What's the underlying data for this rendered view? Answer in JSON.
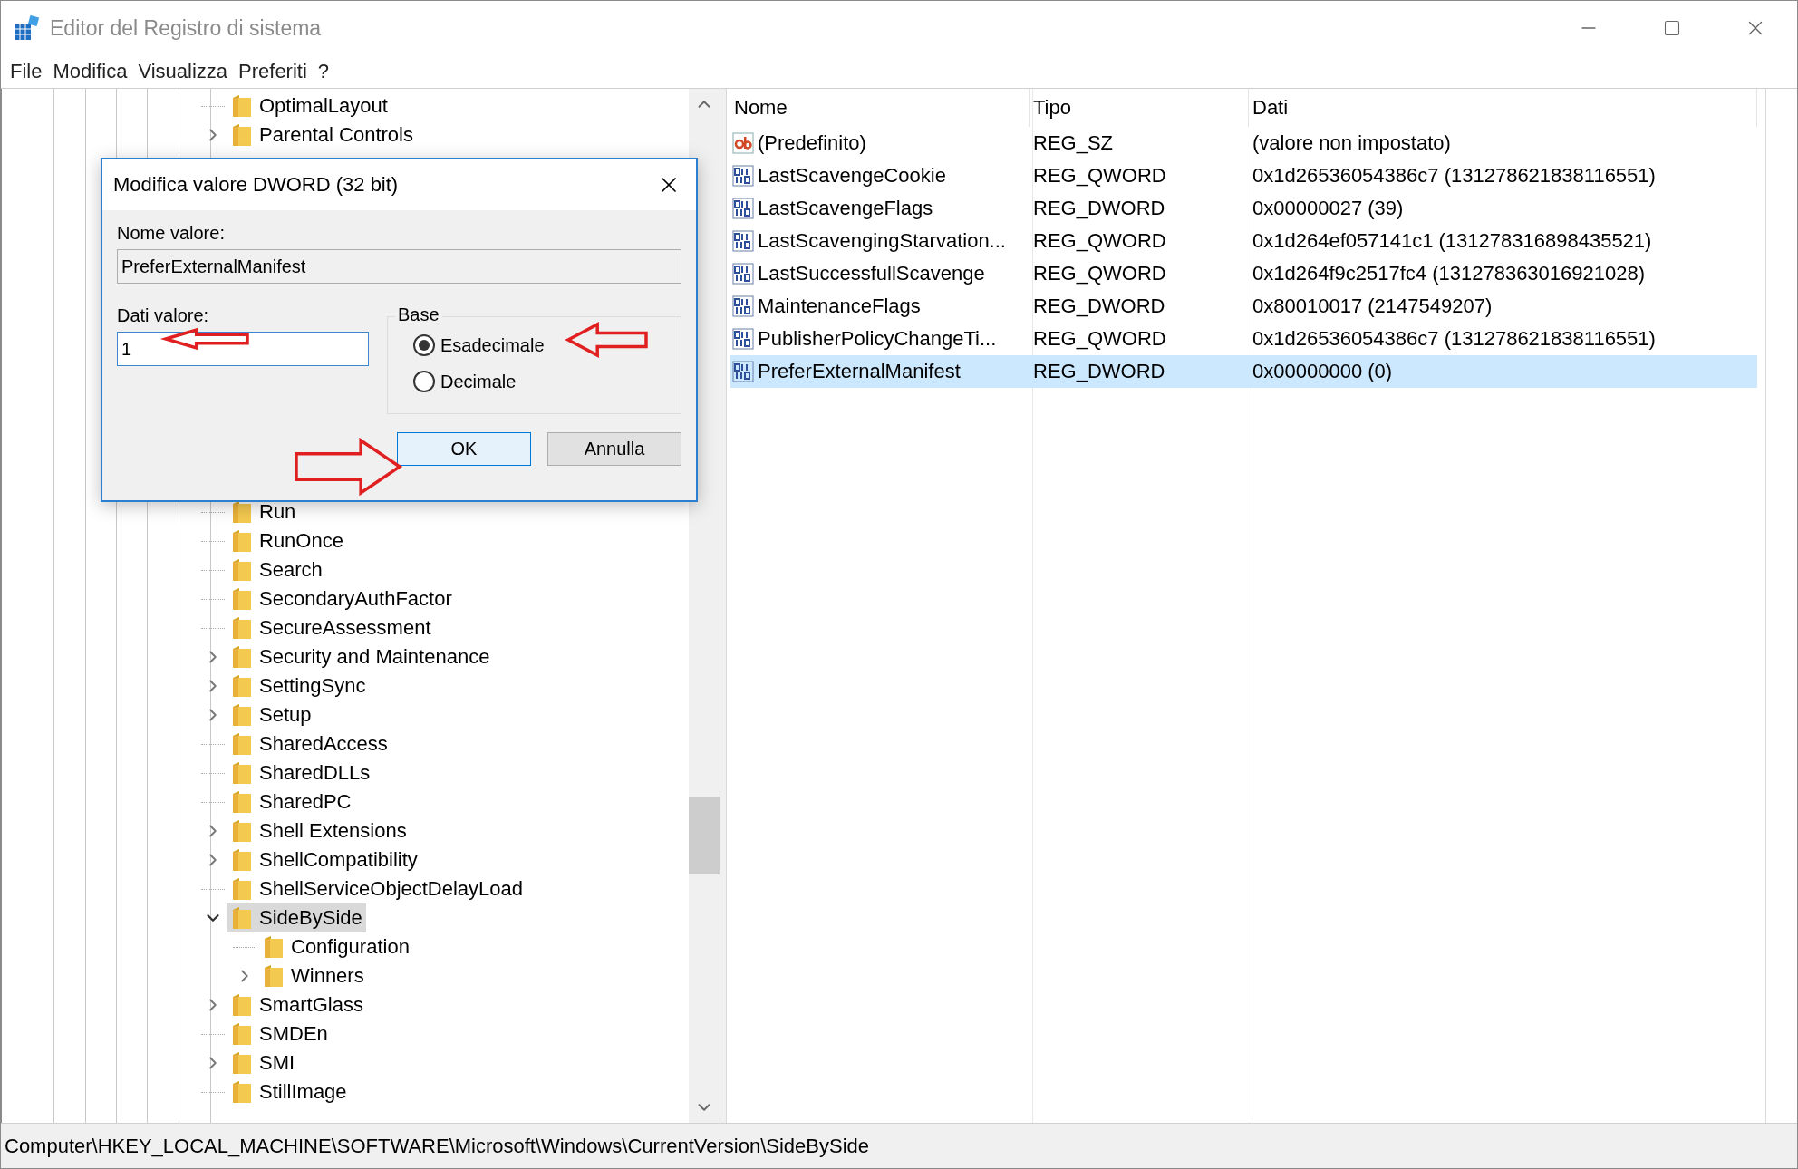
{
  "window": {
    "title": "Editor del Registro di sistema"
  },
  "menu": [
    "File",
    "Modifica",
    "Visualizza",
    "Preferiti",
    "?"
  ],
  "tree": {
    "items": [
      {
        "label": "OptimalLayout",
        "expandable": false,
        "expanded": false,
        "selected": false
      },
      {
        "label": "Parental Controls",
        "expandable": true,
        "expanded": false,
        "selected": false
      },
      {
        "label": "Run",
        "expandable": false,
        "expanded": false,
        "selected": false
      },
      {
        "label": "RunOnce",
        "expandable": false,
        "expanded": false,
        "selected": false
      },
      {
        "label": "Search",
        "expandable": false,
        "expanded": false,
        "selected": false
      },
      {
        "label": "SecondaryAuthFactor",
        "expandable": false,
        "expanded": false,
        "selected": false
      },
      {
        "label": "SecureAssessment",
        "expandable": false,
        "expanded": false,
        "selected": false
      },
      {
        "label": "Security and Maintenance",
        "expandable": true,
        "expanded": false,
        "selected": false
      },
      {
        "label": "SettingSync",
        "expandable": true,
        "expanded": false,
        "selected": false
      },
      {
        "label": "Setup",
        "expandable": true,
        "expanded": false,
        "selected": false
      },
      {
        "label": "SharedAccess",
        "expandable": false,
        "expanded": false,
        "selected": false
      },
      {
        "label": "SharedDLLs",
        "expandable": false,
        "expanded": false,
        "selected": false
      },
      {
        "label": "SharedPC",
        "expandable": false,
        "expanded": false,
        "selected": false
      },
      {
        "label": "Shell Extensions",
        "expandable": true,
        "expanded": false,
        "selected": false
      },
      {
        "label": "ShellCompatibility",
        "expandable": true,
        "expanded": false,
        "selected": false
      },
      {
        "label": "ShellServiceObjectDelayLoad",
        "expandable": false,
        "expanded": false,
        "selected": false
      },
      {
        "label": "SideBySide",
        "expandable": true,
        "expanded": true,
        "selected": true,
        "children": [
          {
            "label": "Configuration",
            "expandable": false,
            "expanded": false,
            "selected": false
          },
          {
            "label": "Winners",
            "expandable": true,
            "expanded": false,
            "selected": false
          }
        ]
      },
      {
        "label": "SmartGlass",
        "expandable": true,
        "expanded": false,
        "selected": false
      },
      {
        "label": "SMDEn",
        "expandable": false,
        "expanded": false,
        "selected": false
      },
      {
        "label": "SMI",
        "expandable": true,
        "expanded": false,
        "selected": false
      },
      {
        "label": "StillImage",
        "expandable": false,
        "expanded": false,
        "selected": false
      }
    ]
  },
  "values": {
    "columns": [
      "Nome",
      "Tipo",
      "Dati"
    ],
    "rows": [
      {
        "kind": "string",
        "name": "(Predefinito)",
        "type": "REG_SZ",
        "data": "(valore non impostato)",
        "selected": false
      },
      {
        "kind": "binary",
        "name": "LastScavengeCookie",
        "type": "REG_QWORD",
        "data": "0x1d26536054386c7 (131278621838116551)",
        "selected": false
      },
      {
        "kind": "binary",
        "name": "LastScavengeFlags",
        "type": "REG_DWORD",
        "data": "0x00000027 (39)",
        "selected": false
      },
      {
        "kind": "binary",
        "name": "LastScavengingStarvation...",
        "type": "REG_QWORD",
        "data": "0x1d264ef057141c1 (131278316898435521)",
        "selected": false
      },
      {
        "kind": "binary",
        "name": "LastSuccessfullScavenge",
        "type": "REG_QWORD",
        "data": "0x1d264f9c2517fc4 (131278363016921028)",
        "selected": false
      },
      {
        "kind": "binary",
        "name": "MaintenanceFlags",
        "type": "REG_DWORD",
        "data": "0x80010017 (2147549207)",
        "selected": false
      },
      {
        "kind": "binary",
        "name": "PublisherPolicyChangeTi...",
        "type": "REG_QWORD",
        "data": "0x1d26536054386c7 (131278621838116551)",
        "selected": false
      },
      {
        "kind": "binary",
        "name": "PreferExternalManifest",
        "type": "REG_DWORD",
        "data": "0x00000000 (0)",
        "selected": true
      }
    ]
  },
  "dialog": {
    "title": "Modifica valore DWORD (32 bit)",
    "name_label": "Nome valore:",
    "name_value": "PreferExternalManifest",
    "data_label": "Dati valore:",
    "data_value": "1",
    "base": {
      "label": "Base",
      "options": [
        {
          "label": "Esadecimale",
          "selected": true
        },
        {
          "label": "Decimale",
          "selected": false
        }
      ]
    },
    "buttons": [
      {
        "label": "OK",
        "default": true
      },
      {
        "label": "Annulla",
        "default": false
      }
    ]
  },
  "status_bar": {
    "path": "Computer\\HKEY_LOCAL_MACHINE\\SOFTWARE\\Microsoft\\Windows\\CurrentVersion\\SideBySide"
  }
}
